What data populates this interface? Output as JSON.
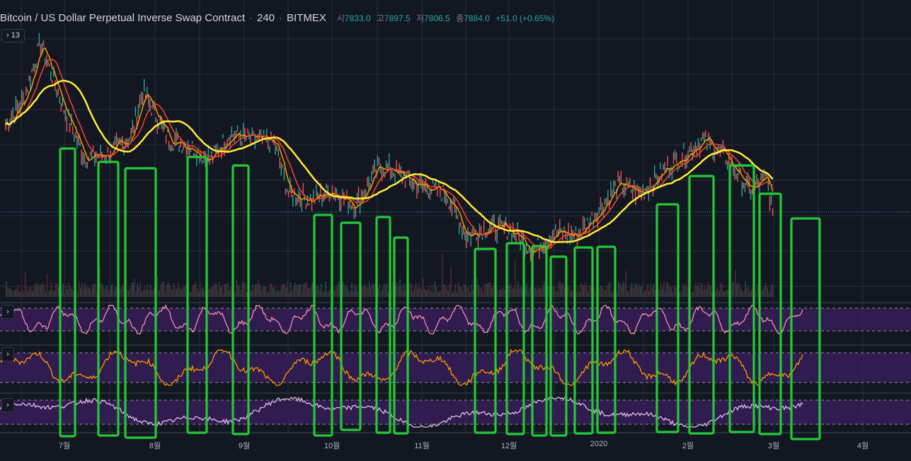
{
  "header": {
    "title": "Bitcoin / US Dollar Perpetual Inverse Swap Contract",
    "interval": "240",
    "exchange": "BITMEX",
    "open_label": "시",
    "open": "7833.0",
    "high_label": "고",
    "high": "7897.5",
    "low_label": "저",
    "low": "7806.5",
    "close_label": "종",
    "close": "7884.0",
    "change": "+51.0 (+0.65%)"
  },
  "legend_toggle": {
    "icon": "chevron-right-icon",
    "count": "13"
  },
  "pane_buttons": [
    "chevron-right-icon",
    "chevron-right-icon",
    "chevron-right-icon"
  ],
  "colors": {
    "background": "#131722",
    "grid": "#2a2e39",
    "ma_fast": "#ff9800",
    "ma_mid": "#f44336",
    "ma_slow": "#ffeb3b",
    "highlight_box": "#22c935",
    "osc_band": "#3b1f5e",
    "osc1_line": "#f48fb1",
    "osc2_line": "#ff9800",
    "osc3_line": "#e1bee7"
  },
  "x_axis": [
    {
      "label": "7월"
    },
    {
      "label": "8월"
    },
    {
      "label": "9월"
    },
    {
      "label": "10월"
    },
    {
      "label": "11월"
    },
    {
      "label": "12월"
    },
    {
      "label": "2020"
    },
    {
      "label": "2월"
    },
    {
      "label": "3월"
    },
    {
      "label": "4월"
    }
  ],
  "chart_data": {
    "type": "line",
    "price_series": {
      "name": "BTC 240",
      "x": [
        "2019-06-20",
        "2019-06-26",
        "2019-07-02",
        "2019-07-10",
        "2019-07-17",
        "2019-07-25",
        "2019-08-02",
        "2019-08-06",
        "2019-08-15",
        "2019-08-22",
        "2019-08-29",
        "2019-09-05",
        "2019-09-12",
        "2019-09-20",
        "2019-09-25",
        "2019-10-03",
        "2019-10-10",
        "2019-10-18",
        "2019-10-26",
        "2019-10-30",
        "2019-11-08",
        "2019-11-18",
        "2019-11-25",
        "2019-12-03",
        "2019-12-10",
        "2019-12-18",
        "2019-12-25",
        "2020-01-02",
        "2020-01-09",
        "2020-01-16",
        "2020-01-24",
        "2020-02-01",
        "2020-02-09",
        "2020-02-14",
        "2020-02-22",
        "2020-03-01",
        "2020-03-07",
        "2020-03-09"
      ],
      "y": [
        10800,
        11600,
        13500,
        11300,
        9700,
        9800,
        10400,
        11900,
        10300,
        10100,
        9600,
        10500,
        10300,
        10200,
        8500,
        8300,
        8600,
        8100,
        9400,
        9300,
        8800,
        8500,
        7100,
        7400,
        7300,
        6600,
        7200,
        7100,
        7900,
        8800,
        8500,
        9300,
        9900,
        10300,
        9700,
        8600,
        9000,
        7884
      ]
    },
    "ylim": [
      6000,
      14000
    ],
    "grid": true
  },
  "highlight_boxes_count": 22
}
